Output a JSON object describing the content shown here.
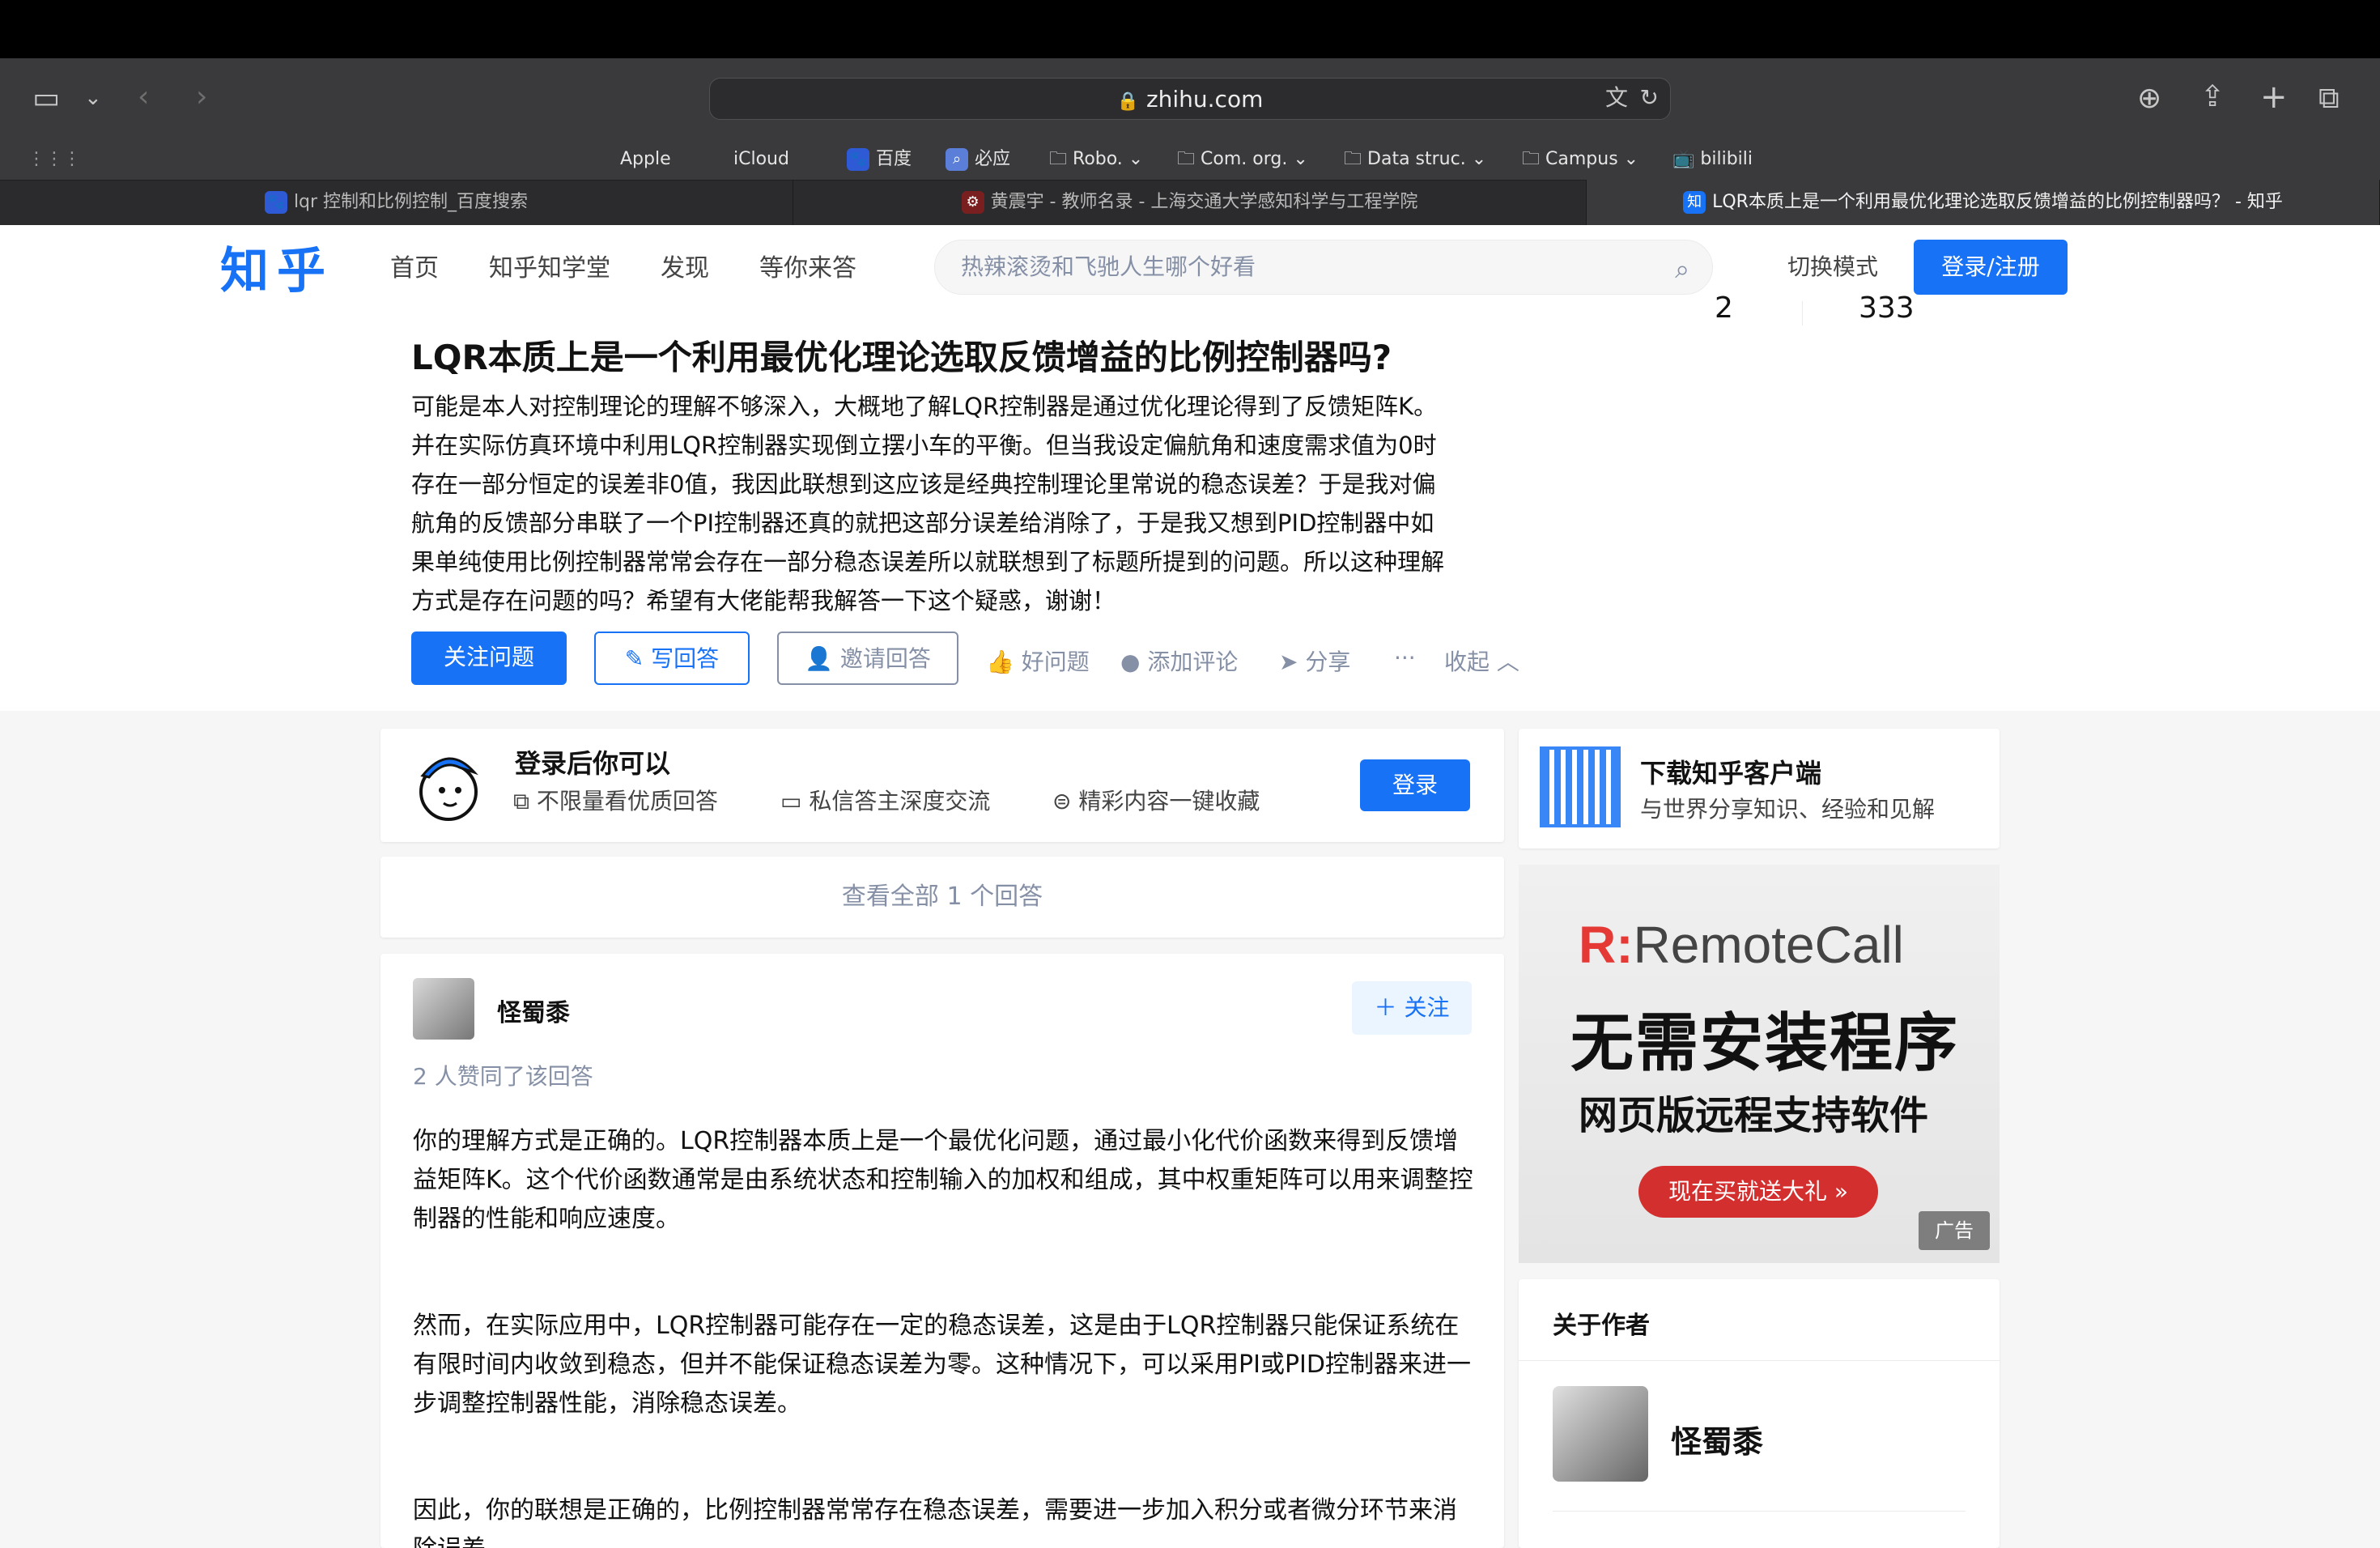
{
  "browser": {
    "url": "zhihu.com",
    "bookmarks": [
      "Apple",
      "iCloud",
      "百度",
      "必应",
      "Robo.",
      "Com. org.",
      "Data struc.",
      "Campus",
      "bilibili"
    ],
    "tabs": [
      {
        "title": "lqr 控制和比例控制_百度搜索",
        "active": false
      },
      {
        "title": "黄震宇 - 教师名录 - 上海交通大学感知科学与工程学院",
        "active": false
      },
      {
        "title": "LQR本质上是一个利用最优化理论选取反馈增益的比例控制器吗？ - 知乎",
        "active": true
      }
    ]
  },
  "header": {
    "logo": "知乎",
    "nav": [
      "首页",
      "知乎知学堂",
      "发现",
      "等你来答"
    ],
    "search_placeholder": "热辣滚烫和飞驰人生哪个好看",
    "switch_mode": "切换模式",
    "login": "登录/注册"
  },
  "question": {
    "title": "LQR本质上是一个利用最优化理论选取反馈增益的比例控制器吗?",
    "description_lines": [
      "可能是本人对控制理论的理解不够深入，大概地了解LQR控制器是通过优化理论得到了反馈矩阵K。",
      "并在实际仿真环境中利用LQR控制器实现倒立摆小车的平衡。但当我设定偏航角和速度需求值为0时",
      "存在一部分恒定的误差非0值，我因此联想到这应该是经典控制理论里常说的稳态误差？于是我对偏",
      "航角的反馈部分串联了一个PI控制器还真的就把这部分误差给消除了，于是我又想到PID控制器中如",
      "果单纯使用比例控制器常常会存在一部分稳态误差所以就联想到了标题所提到的问题。所以这种理解",
      "方式是存在问题的吗？希望有大佬能帮我解答一下这个疑惑，谢谢！"
    ],
    "follow": "关注问题",
    "write": "写回答",
    "invite": "邀请回答",
    "good": "好问题",
    "comment": "添加评论",
    "share": "分享",
    "more": "···",
    "collapse": "收起",
    "stat_left": "2",
    "stat_right": "333"
  },
  "login_prompt": {
    "title": "登录后你可以",
    "features": [
      "不限量看优质回答",
      "私信答主深度交流",
      "精彩内容一键收藏"
    ],
    "button": "登录"
  },
  "view_all": "查看全部 1 个回答",
  "answer": {
    "author": "怪蜀黍",
    "follow": "关注",
    "agree": "2 人赞同了该回答",
    "paragraphs": [
      "你的理解方式是正确的。LQR控制器本质上是一个最优化问题，通过最小化代价函数来得到反馈增益矩阵K。这个代价函数通常是由系统状态和控制输入的加权和组成，其中权重矩阵可以用来调整控制器的性能和响应速度。",
      "然而，在实际应用中，LQR控制器可能存在一定的稳态误差，这是由于LQR控制器只能保证系统在有限时间内收敛到稳态，但并不能保证稳态误差为零。这种情况下，可以采用PI或PID控制器来进一步调整控制器性能，消除稳态误差。",
      "因此，你的联想是正确的，比例控制器常常存在稳态误差，需要进一步加入积分或者微分环节来消除误差。"
    ]
  },
  "sidebar": {
    "app_title": "下载知乎客户端",
    "app_subtitle": "与世界分享知识、经验和见解",
    "ad": {
      "brand": "RemoteCall",
      "headline": "无需安装程序",
      "subline": "网页版远程支持软件",
      "cta": "现在买就送大礼",
      "tag": "广告"
    },
    "about_title": "关于作者",
    "about_name": "怪蜀黍"
  }
}
